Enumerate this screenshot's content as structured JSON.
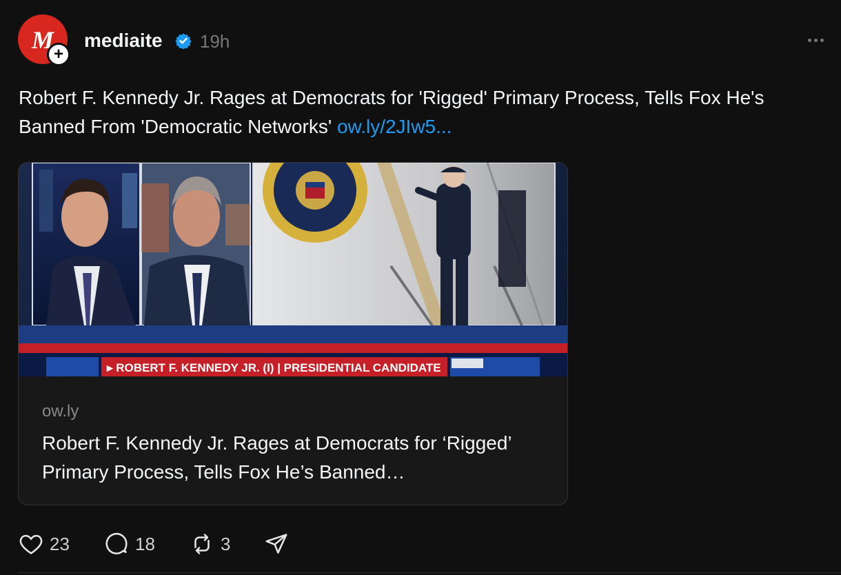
{
  "post": {
    "author": {
      "avatar_letter": "M",
      "username": "mediaite",
      "verified": true,
      "verified_icon": "verified-badge-icon",
      "timestamp": "19h"
    },
    "text": "Robert F. Kennedy Jr. Rages at Democrats for 'Rigged' Primary Process, Tells Fox He's Banned From 'Democratic Networks'",
    "link_text": "ow.ly/2JIw5...",
    "card": {
      "image_chyron": "▸ ROBERT F. KENNEDY JR. (I) | PRESIDENTIAL CANDIDATE",
      "domain": "ow.ly",
      "title": "Robert F. Kennedy Jr. Rages at Democrats for ‘Rigged’ Primary Process, Tells Fox He’s Banned…"
    },
    "actions": {
      "likes": "23",
      "replies": "18",
      "reposts": "3"
    }
  },
  "colors": {
    "background": "#101010",
    "link": "#1d9bf0",
    "avatar_bg": "#d8271f",
    "verified": "#1d9bf0"
  }
}
